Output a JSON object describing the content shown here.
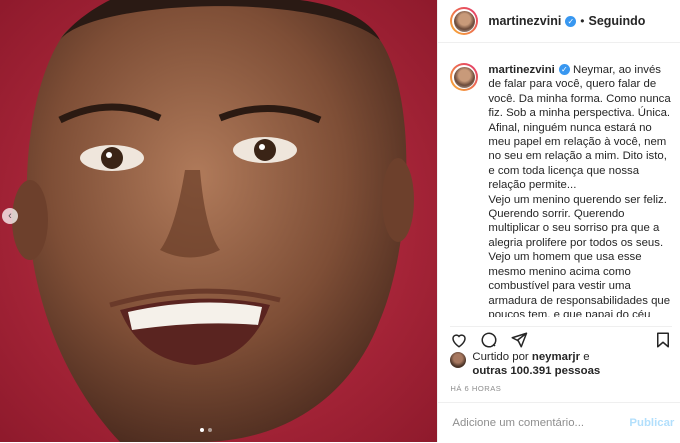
{
  "post": {
    "username": "martinezvini",
    "separator": "•",
    "follow_status": "Seguindo",
    "caption": "Neymar, ao invés de falar para você, quero falar de você. Da minha forma. Como nunca fiz. Sob a minha perspectiva. Única. Afinal, ninguém nunca estará no meu papel em relação à você, nem no seu em relação a mim. Dito isto, e com toda licença que nossa relação permite...\nVejo um menino querendo ser feliz. Querendo sorrir. Querendo multiplicar o seu sorriso pra que a alegria prolifere por todos os seus.\nVejo um homem que usa esse mesmo menino acima como combustível para vestir uma armadura de responsabilidades que poucos tem, e que papai do céu colocou em ti sabendo do que estava fazendo. Elas não são fáceis. Nunca serão, e não",
    "liked_prefix": "Curtido por",
    "liked_user": "neymarjr",
    "liked_conj": "e",
    "liked_others": "outras 100.391 pessoas",
    "time_ago": "HÁ 6 HORAS",
    "comment_placeholder": "Adicione um comentário...",
    "publish_label": "Publicar"
  },
  "carousel": {
    "prev_icon": "‹",
    "slides": 2,
    "active_slide": 1
  },
  "colors": {
    "verified": "#3897f0",
    "photo_bg": "#b3263a",
    "publish_disabled": "#b2dffc"
  }
}
